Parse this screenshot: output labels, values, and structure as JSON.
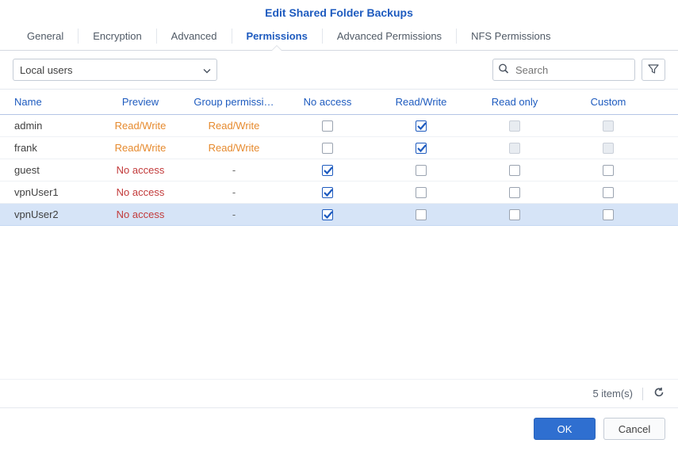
{
  "title": "Edit Shared Folder Backups",
  "tabs": [
    {
      "label": "General",
      "active": false
    },
    {
      "label": "Encryption",
      "active": false
    },
    {
      "label": "Advanced",
      "active": false
    },
    {
      "label": "Permissions",
      "active": true
    },
    {
      "label": "Advanced Permissions",
      "active": false
    },
    {
      "label": "NFS Permissions",
      "active": false
    }
  ],
  "user_scope": {
    "selected": "Local users"
  },
  "search": {
    "placeholder": "Search"
  },
  "columns": {
    "name": "Name",
    "preview": "Preview",
    "group": "Group permissi…",
    "no_access": "No access",
    "read_write": "Read/Write",
    "read_only": "Read only",
    "custom": "Custom"
  },
  "rows": [
    {
      "name": "admin",
      "preview": "Read/Write",
      "preview_kind": "rw",
      "group": "Read/Write",
      "group_kind": "rw",
      "no_access": false,
      "read_write": true,
      "read_only": false,
      "read_only_disabled": true,
      "custom": false,
      "custom_disabled": true,
      "selected": false
    },
    {
      "name": "frank",
      "preview": "Read/Write",
      "preview_kind": "rw",
      "group": "Read/Write",
      "group_kind": "rw",
      "no_access": false,
      "read_write": true,
      "read_only": false,
      "read_only_disabled": true,
      "custom": false,
      "custom_disabled": true,
      "selected": false
    },
    {
      "name": "guest",
      "preview": "No access",
      "preview_kind": "na",
      "group": "-",
      "group_kind": "dash",
      "no_access": true,
      "read_write": false,
      "read_only": false,
      "read_only_disabled": false,
      "custom": false,
      "custom_disabled": false,
      "selected": false
    },
    {
      "name": "vpnUser1",
      "preview": "No access",
      "preview_kind": "na",
      "group": "-",
      "group_kind": "dash",
      "no_access": true,
      "read_write": false,
      "read_only": false,
      "read_only_disabled": false,
      "custom": false,
      "custom_disabled": false,
      "selected": false
    },
    {
      "name": "vpnUser2",
      "preview": "No access",
      "preview_kind": "na",
      "group": "-",
      "group_kind": "dash",
      "no_access": true,
      "read_write": false,
      "read_only": false,
      "read_only_disabled": false,
      "custom": false,
      "custom_disabled": false,
      "selected": true
    }
  ],
  "status": {
    "count_text": "5 item(s)"
  },
  "buttons": {
    "ok": "OK",
    "cancel": "Cancel"
  }
}
